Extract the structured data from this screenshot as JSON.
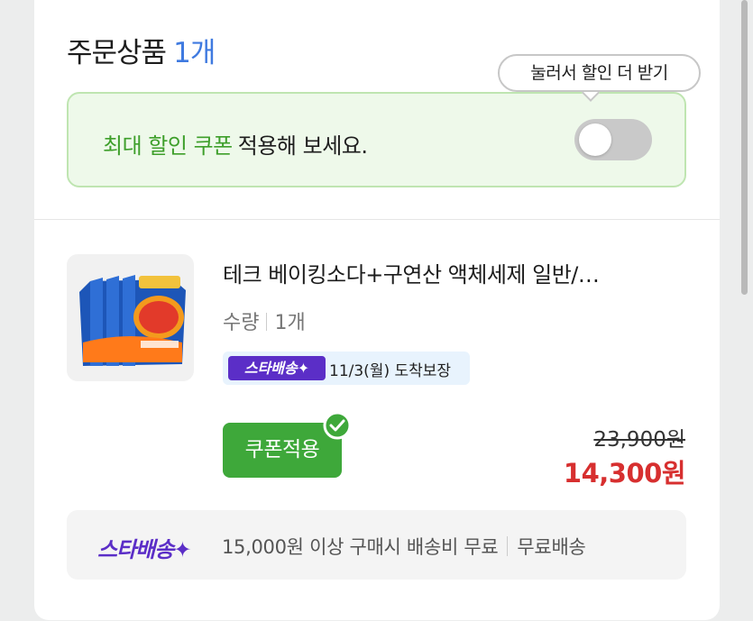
{
  "order": {
    "title": "주문상품",
    "count": "1개"
  },
  "coupon_banner": {
    "highlight": "최대 할인 쿠폰",
    "rest": "적용해 보세요.",
    "tooltip": "눌러서 할인 더 받기",
    "toggle_on": false
  },
  "product": {
    "name": "테크 베이킹소다+구연산 액체세제 일반/…",
    "qty_label": "수량",
    "qty_value": "1개",
    "delivery_badge": "스타배송✦",
    "delivery_text": "11/3(월) 도착보장",
    "coupon_button": "쿠폰적용",
    "original_price": "23,900원",
    "sale_price": "14,300원"
  },
  "shipping": {
    "logo": "스타배송✦",
    "condition": "15,000원 이상 구매시 배송비 무료",
    "status": "무료배송"
  },
  "colors": {
    "accent_blue": "#3f7ae0",
    "coupon_green": "#3ea83a",
    "sale_red": "#d72f2f",
    "star_purple": "#5b2ec7"
  }
}
